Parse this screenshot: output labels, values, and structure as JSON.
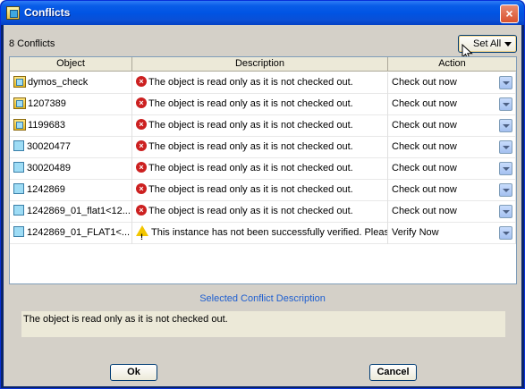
{
  "window": {
    "title": "Conflicts",
    "close_glyph": "×"
  },
  "conflict_count": "8 Conflicts",
  "set_all_label": "Set All",
  "columns": [
    "Object",
    "Description",
    "Action"
  ],
  "rows": [
    {
      "object": "dymos_check",
      "object_icon": "assembly-icon",
      "status_icon": "error-icon",
      "description": "The object is read only as it is not checked out.",
      "action": "Check out now"
    },
    {
      "object": "1207389",
      "object_icon": "assembly-icon",
      "status_icon": "error-icon",
      "description": "The object is read only as it is not checked out.",
      "action": "Check out now"
    },
    {
      "object": "1199683",
      "object_icon": "assembly-icon",
      "status_icon": "error-icon",
      "description": "The object is read only as it is not checked out.",
      "action": "Check out now"
    },
    {
      "object": "30020477",
      "object_icon": "part-icon",
      "status_icon": "error-icon",
      "description": "The object is read only as it is not checked out.",
      "action": "Check out now"
    },
    {
      "object": "30020489",
      "object_icon": "part-icon",
      "status_icon": "error-icon",
      "description": "The object is read only as it is not checked out.",
      "action": "Check out now"
    },
    {
      "object": "1242869",
      "object_icon": "part-icon",
      "status_icon": "error-icon",
      "description": "The object is read only as it is not checked out.",
      "action": "Check out now"
    },
    {
      "object": "1242869_01_flat1<12...",
      "object_icon": "part-icon",
      "status_icon": "error-icon",
      "description": "The object is read only as it is not checked out.",
      "action": "Check out now"
    },
    {
      "object": "1242869_01_FLAT1<...",
      "object_icon": "part-icon",
      "status_icon": "warning-icon",
      "description": "This instance has not been successfully verified. Pleas...",
      "action": "Verify Now"
    }
  ],
  "selected_description_caption": "Selected Conflict Description",
  "selected_description_text": "The object is read only as it is not checked out.",
  "ok_label": "Ok",
  "cancel_label": "Cancel"
}
